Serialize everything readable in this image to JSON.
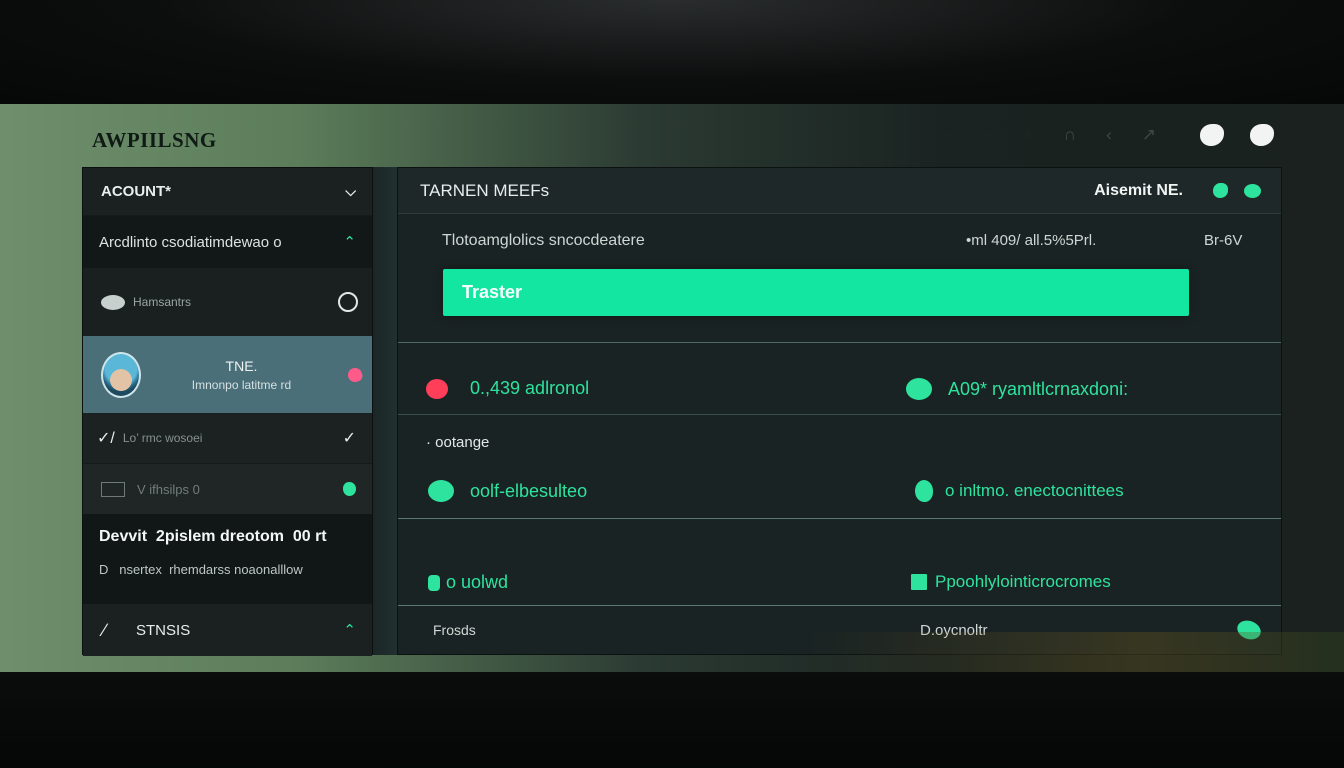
{
  "app": {
    "title": "AWPIILSNG"
  },
  "topbar": {
    "icons": [
      "dot",
      "dot",
      "dot",
      "headset-icon",
      "back-icon",
      "forward-icon",
      "app-icon",
      "profile-icon"
    ]
  },
  "sidebar": {
    "account_header": "ACOUNT*",
    "accounts_sub": "Arcdlinto csodiatimdewao o",
    "item_label": "Hamsantrs",
    "profile": {
      "name": "TNE.",
      "subtitle": "Imnonpo latitme rd"
    },
    "check_label": "Lo’ rmc wosoei",
    "vis_label": "V ifhsilps 0",
    "device": {
      "title": "Devvit  2pislem dreotom  00 rt",
      "subtitle": "D   nsertex  rhemdarss noaonalllow"
    },
    "settings_label": "STNSIS"
  },
  "main": {
    "title": "TARNEN MEEFs",
    "user": "Aisemit NE.",
    "subtitle": "Tlotoamglolics sncocdeatere",
    "meta1": "•ml 409/  all.5%5Prl.",
    "meta2": "Br-6V",
    "green_button": "Traster",
    "rows": [
      {
        "left": "0.,439 adlronol",
        "right": "A09* ryamltlcrnaxdoni:"
      },
      {
        "section": "· ootange"
      },
      {
        "left": "oolf-elbesulteo",
        "right": "o inltmo. enectocnittees"
      },
      {
        "left": "o uolwd",
        "right": "Ppoohlylointicrocromes"
      }
    ],
    "footer_left": "Frosds",
    "footer_mid": "D.oycnoltr"
  },
  "colors": {
    "accent": "#12e6a0",
    "danger": "#ff3e5a",
    "profile_bg": "#4a6f78"
  }
}
